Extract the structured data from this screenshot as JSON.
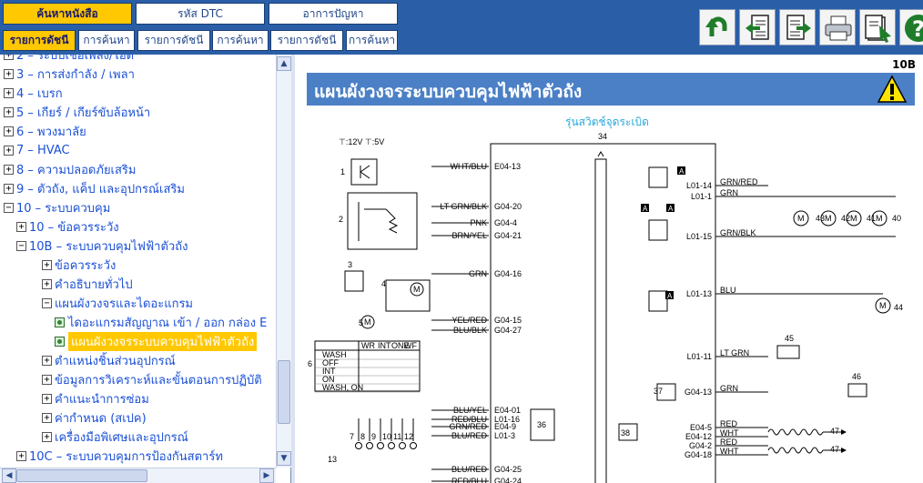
{
  "nav": {
    "tabs_top": [
      "ค้นหาหนังสือ",
      "รหัส DTC",
      "อาการปัญหา"
    ],
    "tabs_bottom": [
      "รายการดัชนี",
      "การค้นหา",
      "รายการดัชนี",
      "การค้นหา",
      "รายการดัชนี",
      "การค้นหา"
    ]
  },
  "toolbar": {
    "icons": [
      "back-icon",
      "prev-page-icon",
      "next-page-icon",
      "print-icon",
      "bookmark-icon",
      "help-icon"
    ]
  },
  "tree": {
    "partial_top": "2 – ระบบเชื้อเพลิง/ไอดี",
    "items": [
      {
        "toggle": "+",
        "label": "3 – การส่งกำลัง / เพลา"
      },
      {
        "toggle": "+",
        "label": "4 – เบรก"
      },
      {
        "toggle": "+",
        "label": "5 – เกียร์ / เกียร์ขับล้อหน้า"
      },
      {
        "toggle": "+",
        "label": "6 – พวงมาลัย"
      },
      {
        "toggle": "+",
        "label": "7 – HVAC"
      },
      {
        "toggle": "+",
        "label": "8 – ความปลอดภัยเสริม"
      },
      {
        "toggle": "+",
        "label": "9 – ตัวถัง, แค็ป และอุปกรณ์เสริม"
      },
      {
        "toggle": "−",
        "label": "10 – ระบบควบคุม"
      },
      {
        "toggle": "+",
        "label": "10 – ข้อควรระวัง"
      },
      {
        "toggle": "−",
        "label": "10B – ระบบควบคุมไฟฟ้าตัวถัง"
      },
      {
        "toggle": "+",
        "label": "ข้อควรระวัง"
      },
      {
        "toggle": "+",
        "label": "คำอธิบายทั่วไป"
      },
      {
        "toggle": "−",
        "label": "แผนผังวงจรและไดอะแกรม"
      },
      {
        "toggle": "doc",
        "label": "ไดอะแกรมสัญญาณ เข้า / ออก กล่อง E"
      },
      {
        "toggle": "doc",
        "label": "แผนผังวงจรระบบควบคุมไฟฟ้าตัวถัง",
        "selected": true
      },
      {
        "toggle": "+",
        "label": "ตำแหน่งชิ้นส่วนอุปกรณ์"
      },
      {
        "toggle": "+",
        "label": "ข้อมูลการวิเคราะห์และขั้นตอนการปฏิบัติ"
      },
      {
        "toggle": "+",
        "label": "คำแนะนำการซ่อม"
      },
      {
        "toggle": "+",
        "label": "ค่ากำหนด (สเปค)"
      },
      {
        "toggle": "+",
        "label": "เครื่องมือพิเศษและอุปกรณ์"
      },
      {
        "toggle": "+",
        "label": "10C – ระบบควบคุมการป้องกันสตาร์ท"
      }
    ]
  },
  "content": {
    "page_code": "10B",
    "title": "แผนผังวงจรระบบควบคุมไฟฟ้าตัวถัง",
    "subtitle": "รุ่นสวิตช์จุดระเบิด"
  },
  "diagram": {
    "legend": "⊤:12V ⊤:5V",
    "module_number": "34",
    "left_wires": [
      {
        "color": "WHT/BLU",
        "pin": "E04-13"
      },
      {
        "color": "LT GRN/BLK",
        "pin": "G04-20"
      },
      {
        "color": "PNK",
        "pin": "G04-4"
      },
      {
        "color": "BRN/YEL",
        "pin": "G04-21"
      },
      {
        "color": "GRN",
        "pin": "G04-16"
      },
      {
        "color": "YEL/RED",
        "pin": "G04-15"
      },
      {
        "color": "BLU/BLK",
        "pin": "G04-27"
      },
      {
        "color": "BLU/YEL",
        "pin": "E04-01"
      },
      {
        "color": "RED/BLU",
        "pin": "L01-16"
      },
      {
        "color": "GRN/RED",
        "pin": "E04-9"
      },
      {
        "color": "BLU/RED",
        "pin": "L01-3"
      },
      {
        "color": "BLU/RED",
        "pin": "G04-25"
      },
      {
        "color": "RED/BLU",
        "pin": "G04-24"
      }
    ],
    "right_wires": [
      {
        "pin": "L01-14",
        "color": "GRN/RED"
      },
      {
        "pin": "L01-1",
        "color": "GRN"
      },
      {
        "pin": "L01-15",
        "color": "GRN/BLK"
      },
      {
        "pin": "L01-13",
        "color": "BLU"
      },
      {
        "pin": "L01-11",
        "color": "LT GRN"
      },
      {
        "pin": "G04-13",
        "color": "GRN"
      },
      {
        "pin": "E04-5",
        "color": "RED"
      },
      {
        "pin": "E04-12",
        "color": "WHT"
      },
      {
        "pin": "G04-2",
        "color": "RED"
      },
      {
        "pin": "G04-18",
        "color": "WHT"
      }
    ],
    "component_numbers": [
      "1",
      "2",
      "3",
      "4",
      "5",
      "6",
      "7",
      "8",
      "9",
      "10",
      "11",
      "12",
      "13",
      "36",
      "37",
      "38",
      "40",
      "41",
      "42",
      "43",
      "44",
      "45",
      "46",
      "47",
      "47"
    ],
    "motor_label": "M",
    "tag_label": "A",
    "switch_table": {
      "headers": [
        "WR",
        "INT",
        "ONE",
        "WF"
      ],
      "rows": [
        "WASH",
        "OFF",
        "INT",
        "ON",
        "WASH, ON"
      ]
    }
  }
}
